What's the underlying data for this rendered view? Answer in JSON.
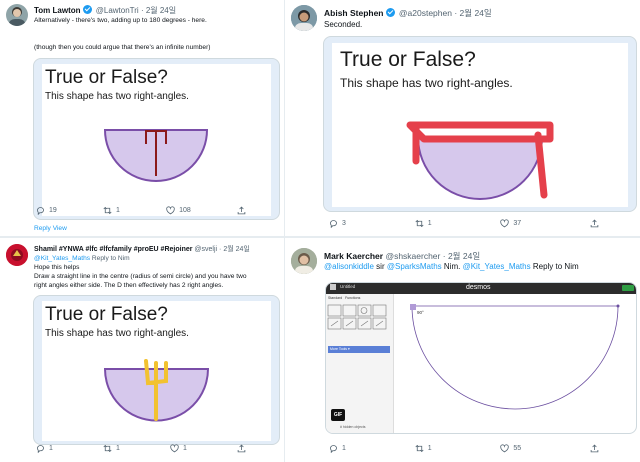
{
  "tweets": [
    {
      "name": "Tom Lawton",
      "handle": "@LawtonTri",
      "date": "2월 24일",
      "text1": "Alternatively - there's two, adding up to 180 degrees - here.",
      "text2": "(though then you could argue that there's an infinite number)",
      "card_title": "True or False?",
      "card_sub": "This shape has two right-angles.",
      "reply_view": "Reply View",
      "stats": {
        "replies": "19",
        "retweets": "1",
        "likes": "108"
      }
    },
    {
      "name": "Abish Stephen",
      "handle": "@a20stephen",
      "date": "2월 24일",
      "text": "Seconded.",
      "card_title": "True or False?",
      "card_sub": "This shape has two right-angles.",
      "stats": {
        "replies": "3",
        "retweets": "1",
        "likes": "37"
      }
    },
    {
      "name": "Shamil #YNWA #lfc #lfcfamily #proEU #Rejoiner",
      "handle": "@svelji",
      "date": "2월 24일",
      "mention": "@Kit_Yates_Maths",
      "reply_to": "Reply to Nim",
      "text1": "Hope this helps",
      "text2": "Draw a straight line in the centre (radius of semi circle) and you have two",
      "text3": "right angles either side. The D then effectively has 2 right angles.",
      "card_title": "True or False?",
      "card_sub": "This shape has two right-angles.",
      "stats": {
        "replies": "1",
        "retweets": "1",
        "likes": "1"
      }
    },
    {
      "name": "Mark Kaercher",
      "handle": "@shskaercher",
      "date": "2월 24일",
      "mention1": "@alisonkiddle",
      "sir": "sir",
      "mention2": "@SparksMaths",
      "nim": "Nim.",
      "mention3": "@Kit_Yates_Maths",
      "reply_to": "Reply to Nim",
      "desmos_title": "desmos",
      "desmos_untitled": "Untitled",
      "desmos_tabs": [
        "Standard",
        "Functions"
      ],
      "desmos_more": "More Tools ▾",
      "desmos_angle": "90°",
      "gif_badge": "GIF",
      "hidden_objects": "# hidden objects",
      "stats": {
        "replies": "1",
        "retweets": "1",
        "likes": "55"
      }
    }
  ],
  "colors": {
    "semicircle_fill": "#d6c8ec",
    "semicircle_stroke": "#7a4ea8",
    "mark_dark_red": "#8b1a1a",
    "mark_red": "#e5404b",
    "mark_yellow": "#f2c230",
    "twitter_blue": "#1d9bf0"
  }
}
